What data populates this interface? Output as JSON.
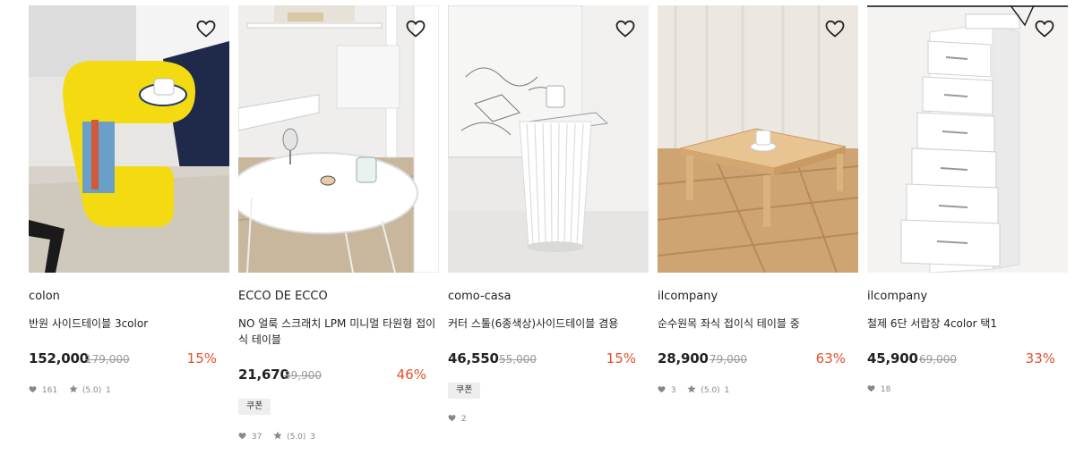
{
  "colors": {
    "discount": "#e2502b",
    "original_price": "#999999",
    "meta": "#888888"
  },
  "icons": {
    "wishlist": "heart-outline-icon",
    "likes": "heart-icon",
    "rating": "star-icon"
  },
  "products": [
    {
      "brand": "colon",
      "name": "반원 사이드테이블 3color",
      "price": "152,000",
      "original_price": "179,000",
      "discount": "15%",
      "coupon": "",
      "likes": "161",
      "rating": "(5.0)",
      "reviews": "1"
    },
    {
      "brand": "ECCO DE ECCO",
      "name": "NO 얼룩 스크래치 LPM 미니멀 타원형 접이식 테이블",
      "price": "21,670",
      "original_price": "39,900",
      "discount": "46%",
      "coupon": "쿠폰",
      "likes": "37",
      "rating": "(5.0)",
      "reviews": "3"
    },
    {
      "brand": "como-casa",
      "name": "커터 스툴(6종색상)사이드테이블 겸용",
      "price": "46,550",
      "original_price": "55,000",
      "discount": "15%",
      "coupon": "쿠폰",
      "likes": "2",
      "rating": "",
      "reviews": ""
    },
    {
      "brand": "ilcompany",
      "name": "순수원목 좌식 접이식 테이블 중",
      "price": "28,900",
      "original_price": "79,000",
      "discount": "63%",
      "coupon": "",
      "likes": "3",
      "rating": "(5.0)",
      "reviews": "1"
    },
    {
      "brand": "ilcompany",
      "name": "철제 6단 서랍장 4color 택1",
      "price": "45,900",
      "original_price": "69,000",
      "discount": "33%",
      "coupon": "",
      "likes": "18",
      "rating": "",
      "reviews": ""
    }
  ]
}
